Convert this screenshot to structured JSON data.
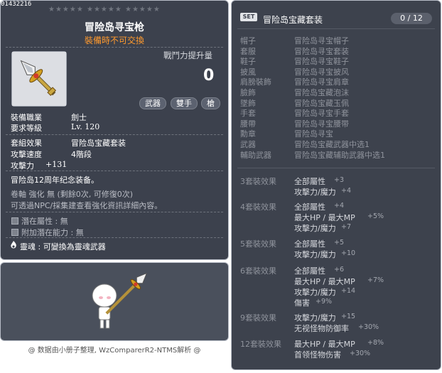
{
  "item": {
    "code": "01432216",
    "stars": "★★★★★ ★★★★★ ★★★★★",
    "name": "冒险岛寻宝枪",
    "trade_note": "裝備時不可交換",
    "icon": "spear-icon",
    "power_label": "戰鬥力提升量",
    "power_value": "0",
    "tags": [
      "武器",
      "雙手",
      "槍"
    ],
    "job_label": "裝備職業",
    "job_value": "劍士",
    "level_label": "要求等級",
    "level_value": "Lv. 120",
    "set_label": "套組效果",
    "set_value": "冒险岛宝藏套装",
    "speed_label": "攻擊速度",
    "speed_value": "4階段",
    "attack_label": "攻擊力",
    "attack_value": "+131",
    "description": "冒险岛12周年纪念装备。",
    "scroll_line": "卷軸 強化 無 (剩餘0次, 可修復0次)",
    "npc_line": "可透過NPC/採集建查看強化資訊詳細內容。",
    "potential_label": "潛在屬性 : 無",
    "bonus_potential_label": "附加潛在能力 : 無",
    "soul_label": "靈魂 : 可變換為靈魂武器",
    "footer": "@ 数据由小册子整理, WzComparerR2-NTMS解析 @"
  },
  "set": {
    "badge": "SET",
    "title": "冒险岛宝藏套装",
    "count": "0 / 12",
    "pieces": [
      {
        "slot": "帽子",
        "name": "冒险岛寻宝帽子"
      },
      {
        "slot": "套服",
        "name": "冒险岛寻宝套装"
      },
      {
        "slot": "鞋子",
        "name": "冒险岛寻宝鞋子"
      },
      {
        "slot": "披風",
        "name": "冒险岛寻宝披风"
      },
      {
        "slot": "肩膀裝飾",
        "name": "冒险岛寻宝肩章"
      },
      {
        "slot": "臉飾",
        "name": "冒险岛宝藏泡沫"
      },
      {
        "slot": "墜飾",
        "name": "冒险岛宝藏玉佩"
      },
      {
        "slot": "手套",
        "name": "冒险岛寻宝手套"
      },
      {
        "slot": "腰帶",
        "name": "冒险岛寻宝腰带"
      },
      {
        "slot": "勳章",
        "name": "冒险岛寻宝"
      },
      {
        "slot": "武器",
        "name": "冒险岛宝藏武器中选1"
      },
      {
        "slot": "輔助武器",
        "name": "冒险岛宝藏辅助武器中选1"
      }
    ],
    "effects": [
      {
        "title": "3套裝效果",
        "lines": [
          {
            "text": "全部屬性",
            "value": "+3"
          },
          {
            "text": "攻擊力/魔力",
            "value": "+4"
          }
        ]
      },
      {
        "title": "4套裝效果",
        "lines": [
          {
            "text": "全部屬性",
            "value": "+4"
          },
          {
            "text": "最大HP / 最大MP",
            "value": "+5%"
          },
          {
            "text": "攻擊力/魔力",
            "value": "+7"
          }
        ]
      },
      {
        "title": "5套裝效果",
        "lines": [
          {
            "text": "全部屬性",
            "value": "+5"
          },
          {
            "text": "攻擊力/魔力",
            "value": "+10"
          }
        ]
      },
      {
        "title": "6套裝效果",
        "lines": [
          {
            "text": "全部屬性",
            "value": "+6"
          },
          {
            "text": "最大HP / 最大MP",
            "value": "+7%"
          },
          {
            "text": "攻擊力/魔力",
            "value": "+14"
          },
          {
            "text": "傷害",
            "value": "+9%"
          }
        ]
      },
      {
        "title": "9套裝效果",
        "lines": [
          {
            "text": "攻擊力/魔力",
            "value": "+15"
          },
          {
            "text": "无视怪物防御率",
            "value": "+30%"
          }
        ]
      },
      {
        "title": "12套裝效果",
        "lines": [
          {
            "text": "最大HP / 最大MP",
            "value": "+8%"
          },
          {
            "text": "首领怪物伤害",
            "value": "+30%"
          }
        ]
      }
    ]
  }
}
